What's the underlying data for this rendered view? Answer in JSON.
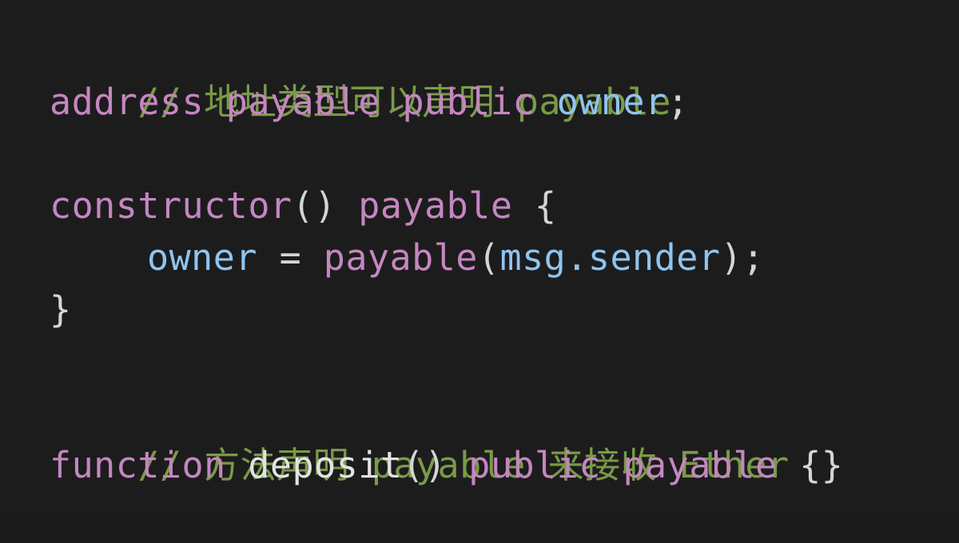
{
  "code": {
    "line1": {
      "comment": "// 地址类型可以声明 payable"
    },
    "line2": {
      "kw1": "address",
      "kw2": "payable",
      "kw3": "public",
      "ident": "owner",
      "semi": ";"
    },
    "line4": {
      "kw1": "constructor",
      "parens": "()",
      "kw2": "payable",
      "brace": "{"
    },
    "line5": {
      "ident1": "owner",
      "eq": "=",
      "kw": "payable",
      "open": "(",
      "ident2": "msg.sender",
      "close": ");"
    },
    "line6": {
      "brace": "}"
    },
    "line8": {
      "comment": "// 方法声明 payable 来接收 Ether"
    },
    "line9": {
      "kw1": "function",
      "name": "deposit",
      "parens": "()",
      "kw2": "public",
      "kw3": "payable",
      "braces": "{}"
    }
  }
}
